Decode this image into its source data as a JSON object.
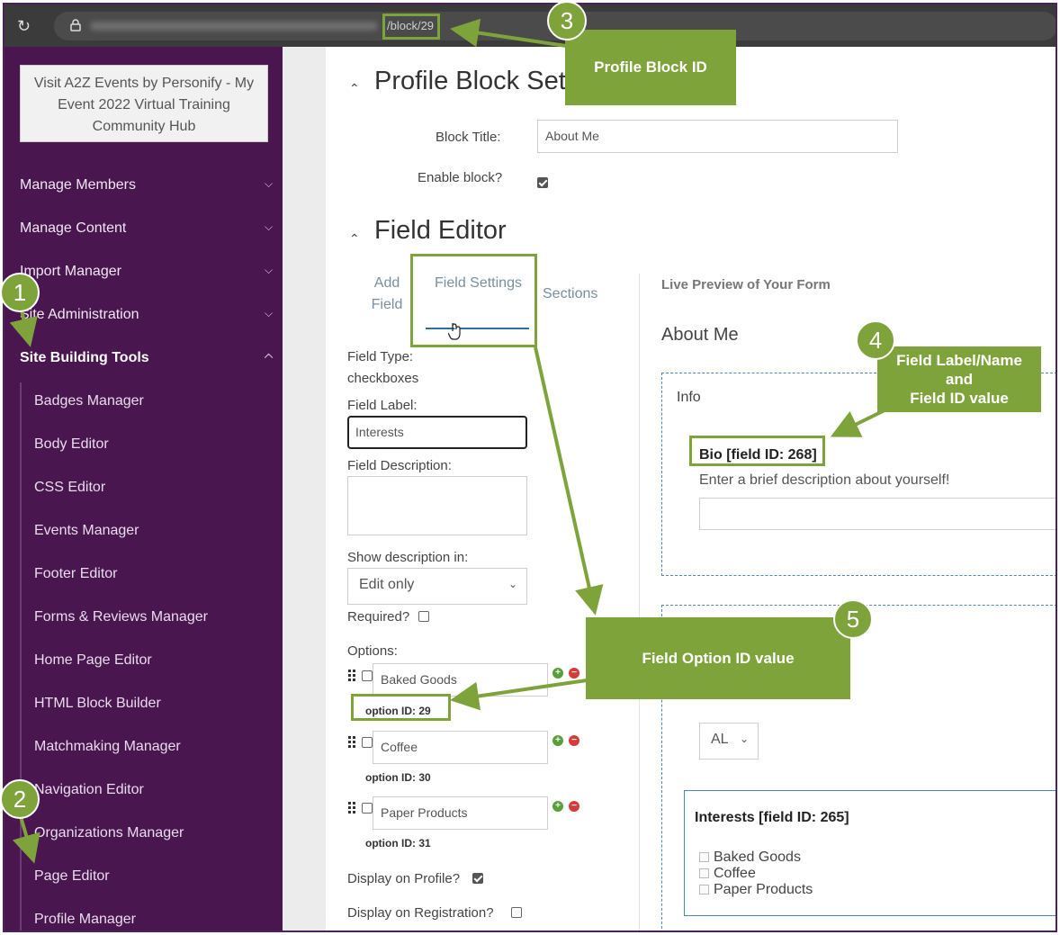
{
  "browser": {
    "url_path": "/block/29"
  },
  "sidebar": {
    "visit_link": "Visit A2Z Events by Personify - My Event 2022 Virtual Training Community Hub",
    "menu": [
      {
        "label": "Manage Members",
        "expanded": false
      },
      {
        "label": "Manage Content",
        "expanded": false
      },
      {
        "label": "Import Manager",
        "expanded": false
      },
      {
        "label": "Site Administration",
        "expanded": false
      },
      {
        "label": "Site Building Tools",
        "expanded": true
      }
    ],
    "submenu": [
      "Badges Manager",
      "Body Editor",
      "CSS Editor",
      "Events Manager",
      "Footer Editor",
      "Forms & Reviews Manager",
      "Home Page Editor",
      "HTML Block Builder",
      "Matchmaking Manager",
      "Navigation Editor",
      "Organizations Manager",
      "Page Editor",
      "Profile Manager"
    ]
  },
  "profile_block": {
    "title": "Profile Block Settings",
    "block_title_label": "Block Title:",
    "block_title_value": "About Me",
    "enable_label": "Enable block?",
    "enable_checked": true
  },
  "field_editor": {
    "title": "Field Editor",
    "tabs": [
      "Add Field",
      "Field Settings",
      "Sections"
    ],
    "active_tab": "Field Settings",
    "field_type_label": "Field Type:",
    "field_type_value": "checkboxes",
    "field_label_label": "Field Label:",
    "field_label_value": "Interests",
    "field_description_label": "Field Description:",
    "show_description_label": "Show description in:",
    "show_description_value": "Edit only",
    "required_label": "Required?",
    "options_label": "Options:",
    "options": [
      {
        "value": "Baked Goods",
        "id_label": "option ID: 29"
      },
      {
        "value": "Coffee",
        "id_label": "option ID: 30"
      },
      {
        "value": "Paper Products",
        "id_label": "option ID: 31"
      }
    ],
    "display_profile_label": "Display on Profile?",
    "display_profile_checked": true,
    "display_registration_label": "Display on Registration?"
  },
  "preview": {
    "heading": "Live Preview of Your Form",
    "form_title": "About Me",
    "section_label": "Info",
    "bio_label": "Bio [field ID: 268]",
    "bio_description": "Enter a brief description about yourself!",
    "state_select": "AL",
    "interests_label": "Interests [field ID: 265]",
    "interests_options": [
      "Baked Goods",
      "Coffee",
      "Paper Products"
    ]
  },
  "annotations": {
    "n1": "1",
    "n2": "2",
    "n3": "3",
    "n4": "4",
    "n5": "5",
    "callout3": "Profile Block ID",
    "callout4_line1": "Field Label/Name",
    "callout4_line2": "and",
    "callout4_line3": "Field ID value",
    "callout5": "Field Option ID value",
    "color": "#7fa33b"
  }
}
